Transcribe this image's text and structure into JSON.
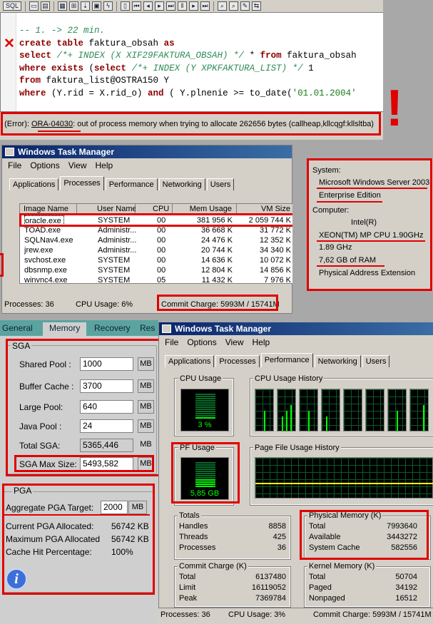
{
  "toolbar": {
    "sql_label": "SQL",
    "icons": [
      "open-icon",
      "save-icon",
      "print-icon",
      "grid-icon",
      "run-icon",
      "export-icon",
      "clipboard-icon",
      "compare-icon",
      "first-icon",
      "prev-icon",
      "play-icon",
      "step-icon",
      "pause-icon",
      "next-icon",
      "last-icon",
      "window-icon",
      "zoom-icon",
      "fit-icon",
      "format-icon"
    ]
  },
  "editor": {
    "lines": [
      {
        "tokens": [
          {
            "t": "-- 1. -> 22 min.",
            "c": "cm"
          }
        ]
      },
      {
        "tokens": [
          {
            "t": "create table ",
            "c": "kw"
          },
          {
            "t": "faktura_obsah ",
            "c": ""
          },
          {
            "t": "as",
            "c": "kw"
          }
        ]
      },
      {
        "tokens": [
          {
            "t": "select ",
            "c": "kw"
          },
          {
            "t": "/*+ INDEX (X XIF29FAKTURA_OBSAH) */ ",
            "c": "cm"
          },
          {
            "t": "* ",
            "c": ""
          },
          {
            "t": "from ",
            "c": "kw"
          },
          {
            "t": "faktura_obsah",
            "c": ""
          }
        ]
      },
      {
        "tokens": [
          {
            "t": "where exists ",
            "c": "kw"
          },
          {
            "t": "(",
            "c": ""
          },
          {
            "t": "select ",
            "c": "kw"
          },
          {
            "t": "/*+ INDEX (Y XPKFAKTURA_LIST) */ ",
            "c": "cm"
          },
          {
            "t": "1",
            "c": ""
          }
        ]
      },
      {
        "tokens": [
          {
            "t": "from ",
            "c": "kw"
          },
          {
            "t": "faktura_list@OSTRA150 Y",
            "c": ""
          }
        ]
      },
      {
        "tokens": [
          {
            "t": "where ",
            "c": "kw"
          },
          {
            "t": "(Y.rid = X.rid_o) ",
            "c": ""
          },
          {
            "t": "and ",
            "c": "kw"
          },
          {
            "t": "( Y.plnenie >= to_date(",
            "c": ""
          },
          {
            "t": "'01.01.2004'",
            "c": "st"
          }
        ]
      }
    ]
  },
  "error": {
    "prefix": ": (Error): ",
    "code": "ORA-04030",
    "message": ": out of process memory when trying to allocate 262656 bytes (callheap,kllcqgf:kllsltba)"
  },
  "annotation": {
    "exclamation": "!"
  },
  "tm1": {
    "title": "Windows Task Manager",
    "menu": [
      "File",
      "Options",
      "View",
      "Help"
    ],
    "tabs": [
      "Applications",
      "Processes",
      "Performance",
      "Networking",
      "Users"
    ],
    "active_tab": "Processes",
    "columns": [
      "Image Name",
      "User Name",
      "CPU",
      "Mem Usage",
      "VM Size"
    ],
    "rows": [
      [
        "oracle.exe",
        "SYSTEM",
        "00",
        "381 956 K",
        "2 059 744 K"
      ],
      [
        "TOAD.exe",
        "Administr...",
        "00",
        "36 668 K",
        "31 772 K"
      ],
      [
        "SQLNav4.exe",
        "Administr...",
        "00",
        "24 476 K",
        "12 352 K"
      ],
      [
        "jrew.exe",
        "Administr...",
        "00",
        "20 744 K",
        "34 340 K"
      ],
      [
        "svchost.exe",
        "SYSTEM",
        "00",
        "14 636 K",
        "10 072 K"
      ],
      [
        "dbsnmp.exe",
        "SYSTEM",
        "00",
        "12 804 K",
        "14 856 K"
      ],
      [
        "winvnc4.exe",
        "SYSTEM",
        "05",
        "11 432 K",
        "7 976 K"
      ]
    ],
    "status": {
      "processes": "Processes: 36",
      "cpu": "CPU Usage: 6%",
      "commit": "Commit Charge: 5993M / 15741M"
    }
  },
  "system": {
    "system_label": "System:",
    "os": "Microsoft Windows Server 2003",
    "edition": "Enterprise Edition",
    "computer_label": "Computer:",
    "cpu_vendor": "Intel(R)",
    "cpu": "XEON(TM) MP CPU 1.90GHz",
    "freq": "1.89 GHz",
    "ram": "7,62 GB of RAM",
    "pae": "Physical Address Extension"
  },
  "props": {
    "tabs": [
      "General",
      "Memory",
      "Recovery",
      "Res"
    ],
    "sga_title": "SGA",
    "sga": [
      {
        "label": "Shared Pool :",
        "value": "1000",
        "unit": "MB"
      },
      {
        "label": "Buffer Cache :",
        "value": "3700",
        "unit": "MB"
      },
      {
        "label": "Large Pool:",
        "value": "640",
        "unit": "MB"
      },
      {
        "label": "Java Pool :",
        "value": "24",
        "unit": "MB"
      },
      {
        "label": "Total SGA:",
        "value": "5365,446",
        "unit": "MB"
      },
      {
        "label": "SGA Max Size:",
        "value": "5493,582",
        "unit": "MB"
      }
    ],
    "pga_title": "PGA",
    "pga_target_label": "Aggregate PGA Target:",
    "pga_target_value": "2000",
    "pga_target_unit": "MB",
    "pga_stats": [
      {
        "label": "Current PGA Allocated:",
        "value": "56742 KB"
      },
      {
        "label": "Maximum PGA Allocated",
        "value": "56742 KB"
      },
      {
        "label": "Cache Hit Percentage:",
        "value": "100%"
      }
    ]
  },
  "tm2": {
    "title": "Windows Task Manager",
    "menu": [
      "File",
      "Options",
      "View",
      "Help"
    ],
    "tabs": [
      "Applications",
      "Processes",
      "Performance",
      "Networking",
      "Users"
    ],
    "active_tab": "Performance",
    "cpu_usage_label": "CPU Usage",
    "cpu_usage_value": "3 %",
    "cpu_usage_fraction": 0.03,
    "cpu_history_label": "CPU Usage History",
    "pf_usage_label": "PF Usage",
    "pf_usage_value": "5,85 GB",
    "pf_usage_fraction": 0.37,
    "pf_history_label": "Page File Usage History",
    "totals": {
      "title": "Totals",
      "rows": [
        [
          "Handles",
          "8858"
        ],
        [
          "Threads",
          "425"
        ],
        [
          "Processes",
          "36"
        ]
      ]
    },
    "physical": {
      "title": "Physical Memory (K)",
      "rows": [
        [
          "Total",
          "7993640"
        ],
        [
          "Available",
          "3443272"
        ],
        [
          "System Cache",
          "582556"
        ]
      ]
    },
    "commit": {
      "title": "Commit Charge (K)",
      "rows": [
        [
          "Total",
          "6137480"
        ],
        [
          "Limit",
          "16119052"
        ],
        [
          "Peak",
          "7369784"
        ]
      ]
    },
    "kernel": {
      "title": "Kernel Memory (K)",
      "rows": [
        [
          "Total",
          "50704"
        ],
        [
          "Paged",
          "34192"
        ],
        [
          "Nonpaged",
          "16512"
        ]
      ]
    },
    "status": {
      "processes": "Processes: 36",
      "cpu": "CPU Usage: 3%",
      "commit": "Commit Charge: 5993M / 15741M"
    }
  },
  "colors": {
    "highlight": "#e00000",
    "monitor_green": "#00ff00",
    "title_blue": "#0a246a"
  }
}
